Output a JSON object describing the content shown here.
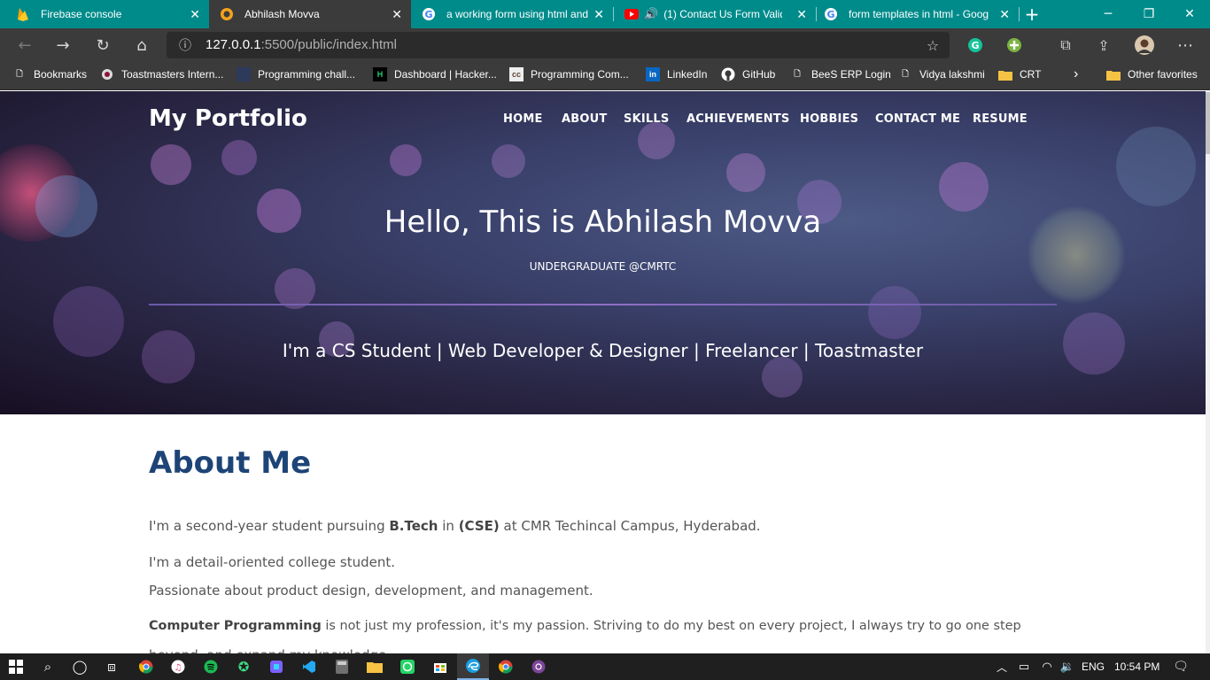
{
  "browser": {
    "tabs": [
      {
        "title": "Firebase console",
        "icon": "firebase-icon",
        "active": false
      },
      {
        "title": "Abhilash Movva",
        "icon": "site-icon",
        "active": true
      },
      {
        "title": "a working form using html and",
        "icon": "google-icon",
        "active": false
      },
      {
        "title": "(1) Contact Us Form Valid",
        "icon": "youtube-icon",
        "active": false
      },
      {
        "title": "form templates in html - Goog",
        "icon": "google-icon",
        "active": false
      }
    ],
    "address": {
      "host": "127.0.0.1",
      "path": ":5500/public/index.html"
    },
    "bookmarks": [
      {
        "label": "Bookmarks",
        "icon": "page-icon"
      },
      {
        "label": "Toastmasters Intern...",
        "icon": "toastmasters-icon"
      },
      {
        "label": "Programming chall...",
        "icon": "page-icon"
      },
      {
        "label": "Dashboard | Hacker...",
        "icon": "hackerearth-icon"
      },
      {
        "label": "Programming Com...",
        "icon": "codechef-icon"
      },
      {
        "label": "LinkedIn",
        "icon": "linkedin-icon"
      },
      {
        "label": "GitHub",
        "icon": "github-icon"
      },
      {
        "label": "BeeS ERP Login",
        "icon": "page-icon"
      },
      {
        "label": "Vidya lakshmi",
        "icon": "page-icon"
      },
      {
        "label": "CRT",
        "icon": "folder-icon"
      },
      {
        "label": "Other favorites",
        "icon": "folder-icon"
      }
    ]
  },
  "page": {
    "brand": "My Portfolio",
    "nav": [
      "HOME",
      "ABOUT",
      "SKILLS",
      "ACHIEVEMENTS",
      "HOBBIES",
      "CONTACT ME",
      "RESUME"
    ],
    "hero_title": "Hello, This is Abhilash Movva",
    "hero_subtitle": "UNDERGRADUATE @CMRTC",
    "hero_tagline": "I'm a CS Student | Web Developer & Designer | Freelancer | Toastmaster",
    "about": {
      "title": "About Me",
      "p1_pre": "I'm a second-year student pursuing ",
      "p1_b1": "B.Tech",
      "p1_mid": " in ",
      "p1_b2": "(CSE)",
      "p1_post": " at CMR Techincal Campus, Hyderabad.",
      "p2": "I'm a detail-oriented college student.",
      "p3": "Passionate about product design, development, and management.",
      "p4_b": "Computer Programming",
      "p4_post": " is not just my profession, it's my passion. Striving to do my best on every project, I always try to go one step",
      "p5": "beyond, and expand my knowledge."
    }
  },
  "taskbar": {
    "language": "ENG",
    "time": "10:54 PM"
  },
  "colors": {
    "tabbar": "#008b8b",
    "chrome": "#3b3b3b",
    "heading": "#1d4477",
    "body_text": "#555555"
  }
}
